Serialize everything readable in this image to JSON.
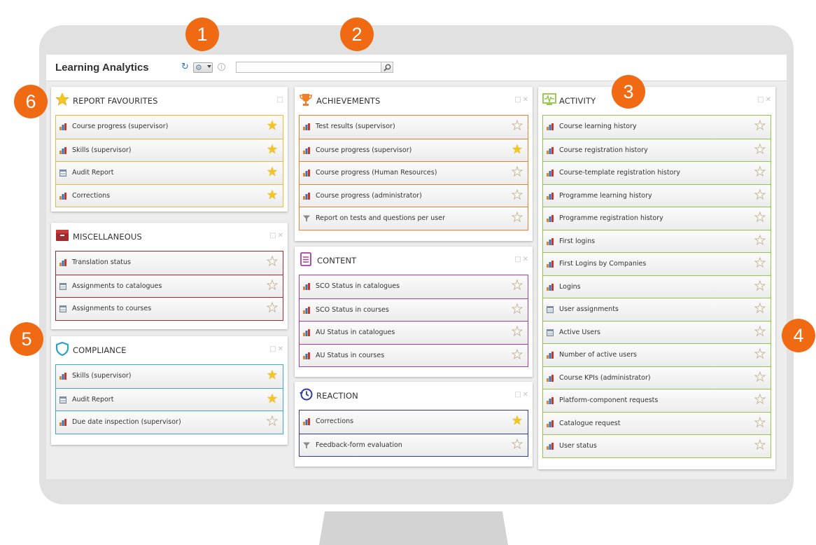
{
  "app": {
    "title": "Learning Analytics",
    "info_glyph": "i"
  },
  "search": {
    "value": "",
    "placeholder": ""
  },
  "callouts": [
    "1",
    "2",
    "3",
    "4",
    "5",
    "6"
  ],
  "colors": {
    "favourites": "#f1b92f",
    "miscellaneous": "#a32a2a",
    "compliance": "#3aaad8",
    "achievements": "#ef7f28",
    "content": "#a93da4",
    "reaction": "#2f3aa8",
    "activity": "#93c548",
    "callout": "#f06a13",
    "star_on": "#f3c61f"
  },
  "panels": {
    "favourites": {
      "title": "REPORT FAVOURITES",
      "icon": "star-icon",
      "rows": [
        {
          "label": "Course progress (supervisor)",
          "icon": "bar-chart-icon",
          "starred": true
        },
        {
          "label": "Skills (supervisor)",
          "icon": "bar-chart-icon",
          "starred": true
        },
        {
          "label": "Audit Report",
          "icon": "table-icon",
          "starred": true
        },
        {
          "label": "Corrections",
          "icon": "bar-chart-icon",
          "starred": true
        }
      ]
    },
    "miscellaneous": {
      "title": "MISCELLANEOUS",
      "icon": "archive-box-icon",
      "rows": [
        {
          "label": "Translation status",
          "icon": "bar-chart-icon",
          "starred": false
        },
        {
          "label": "Assignments to catalogues",
          "icon": "table-icon",
          "starred": false
        },
        {
          "label": "Assignments to courses",
          "icon": "table-icon",
          "starred": false
        }
      ]
    },
    "compliance": {
      "title": "COMPLIANCE",
      "icon": "shield-icon",
      "rows": [
        {
          "label": "Skills (supervisor)",
          "icon": "bar-chart-icon",
          "starred": true
        },
        {
          "label": "Audit Report",
          "icon": "table-icon",
          "starred": true
        },
        {
          "label": "Due date inspection (supervisor)",
          "icon": "bar-chart-icon",
          "starred": false
        }
      ]
    },
    "achievements": {
      "title": "ACHIEVEMENTS",
      "icon": "trophy-icon",
      "rows": [
        {
          "label": "Test results (supervisor)",
          "icon": "bar-chart-icon",
          "starred": false
        },
        {
          "label": "Course progress (supervisor)",
          "icon": "bar-chart-icon",
          "starred": true
        },
        {
          "label": "Course progress (Human Resources)",
          "icon": "bar-chart-icon",
          "starred": false
        },
        {
          "label": "Course progress (administrator)",
          "icon": "bar-chart-icon",
          "starred": false
        },
        {
          "label": "Report on tests and questions per user",
          "icon": "filter-icon",
          "starred": false
        }
      ]
    },
    "content": {
      "title": "CONTENT",
      "icon": "document-icon",
      "rows": [
        {
          "label": "SCO Status in catalogues",
          "icon": "bar-chart-icon",
          "starred": false
        },
        {
          "label": "SCO Status in courses",
          "icon": "bar-chart-icon",
          "starred": false
        },
        {
          "label": "AU Status in catalogues",
          "icon": "bar-chart-icon",
          "starred": false
        },
        {
          "label": "AU Status in courses",
          "icon": "bar-chart-icon",
          "starred": false
        }
      ]
    },
    "reaction": {
      "title": "REACTION",
      "icon": "history-clock-icon",
      "rows": [
        {
          "label": "Corrections",
          "icon": "bar-chart-icon",
          "starred": true
        },
        {
          "label": "Feedback-form evaluation",
          "icon": "filter-icon",
          "starred": false
        }
      ]
    },
    "activity": {
      "title": "ACTIVITY",
      "icon": "activity-monitor-icon",
      "rows": [
        {
          "label": "Course learning history",
          "icon": "bar-chart-icon",
          "starred": false
        },
        {
          "label": "Course registration history",
          "icon": "bar-chart-icon",
          "starred": false
        },
        {
          "label": "Course-template registration history",
          "icon": "bar-chart-icon",
          "starred": false
        },
        {
          "label": "Programme learning history",
          "icon": "bar-chart-icon",
          "starred": false
        },
        {
          "label": "Programme registration history",
          "icon": "bar-chart-icon",
          "starred": false
        },
        {
          "label": "First logins",
          "icon": "bar-chart-icon",
          "starred": false
        },
        {
          "label": "First Logins by Companies",
          "icon": "bar-chart-icon",
          "starred": false
        },
        {
          "label": "Logins",
          "icon": "bar-chart-icon",
          "starred": false
        },
        {
          "label": "User assignments",
          "icon": "table-icon",
          "starred": false
        },
        {
          "label": "Active Users",
          "icon": "table-icon",
          "starred": false
        },
        {
          "label": "Number of active users",
          "icon": "bar-chart-icon",
          "starred": false
        },
        {
          "label": "Course KPIs (administrator)",
          "icon": "bar-chart-icon",
          "starred": false
        },
        {
          "label": "Platform-component requests",
          "icon": "bar-chart-icon",
          "starred": false
        },
        {
          "label": "Catalogue request",
          "icon": "bar-chart-icon",
          "starred": false
        },
        {
          "label": "User status",
          "icon": "bar-chart-icon",
          "starred": false
        }
      ]
    }
  }
}
